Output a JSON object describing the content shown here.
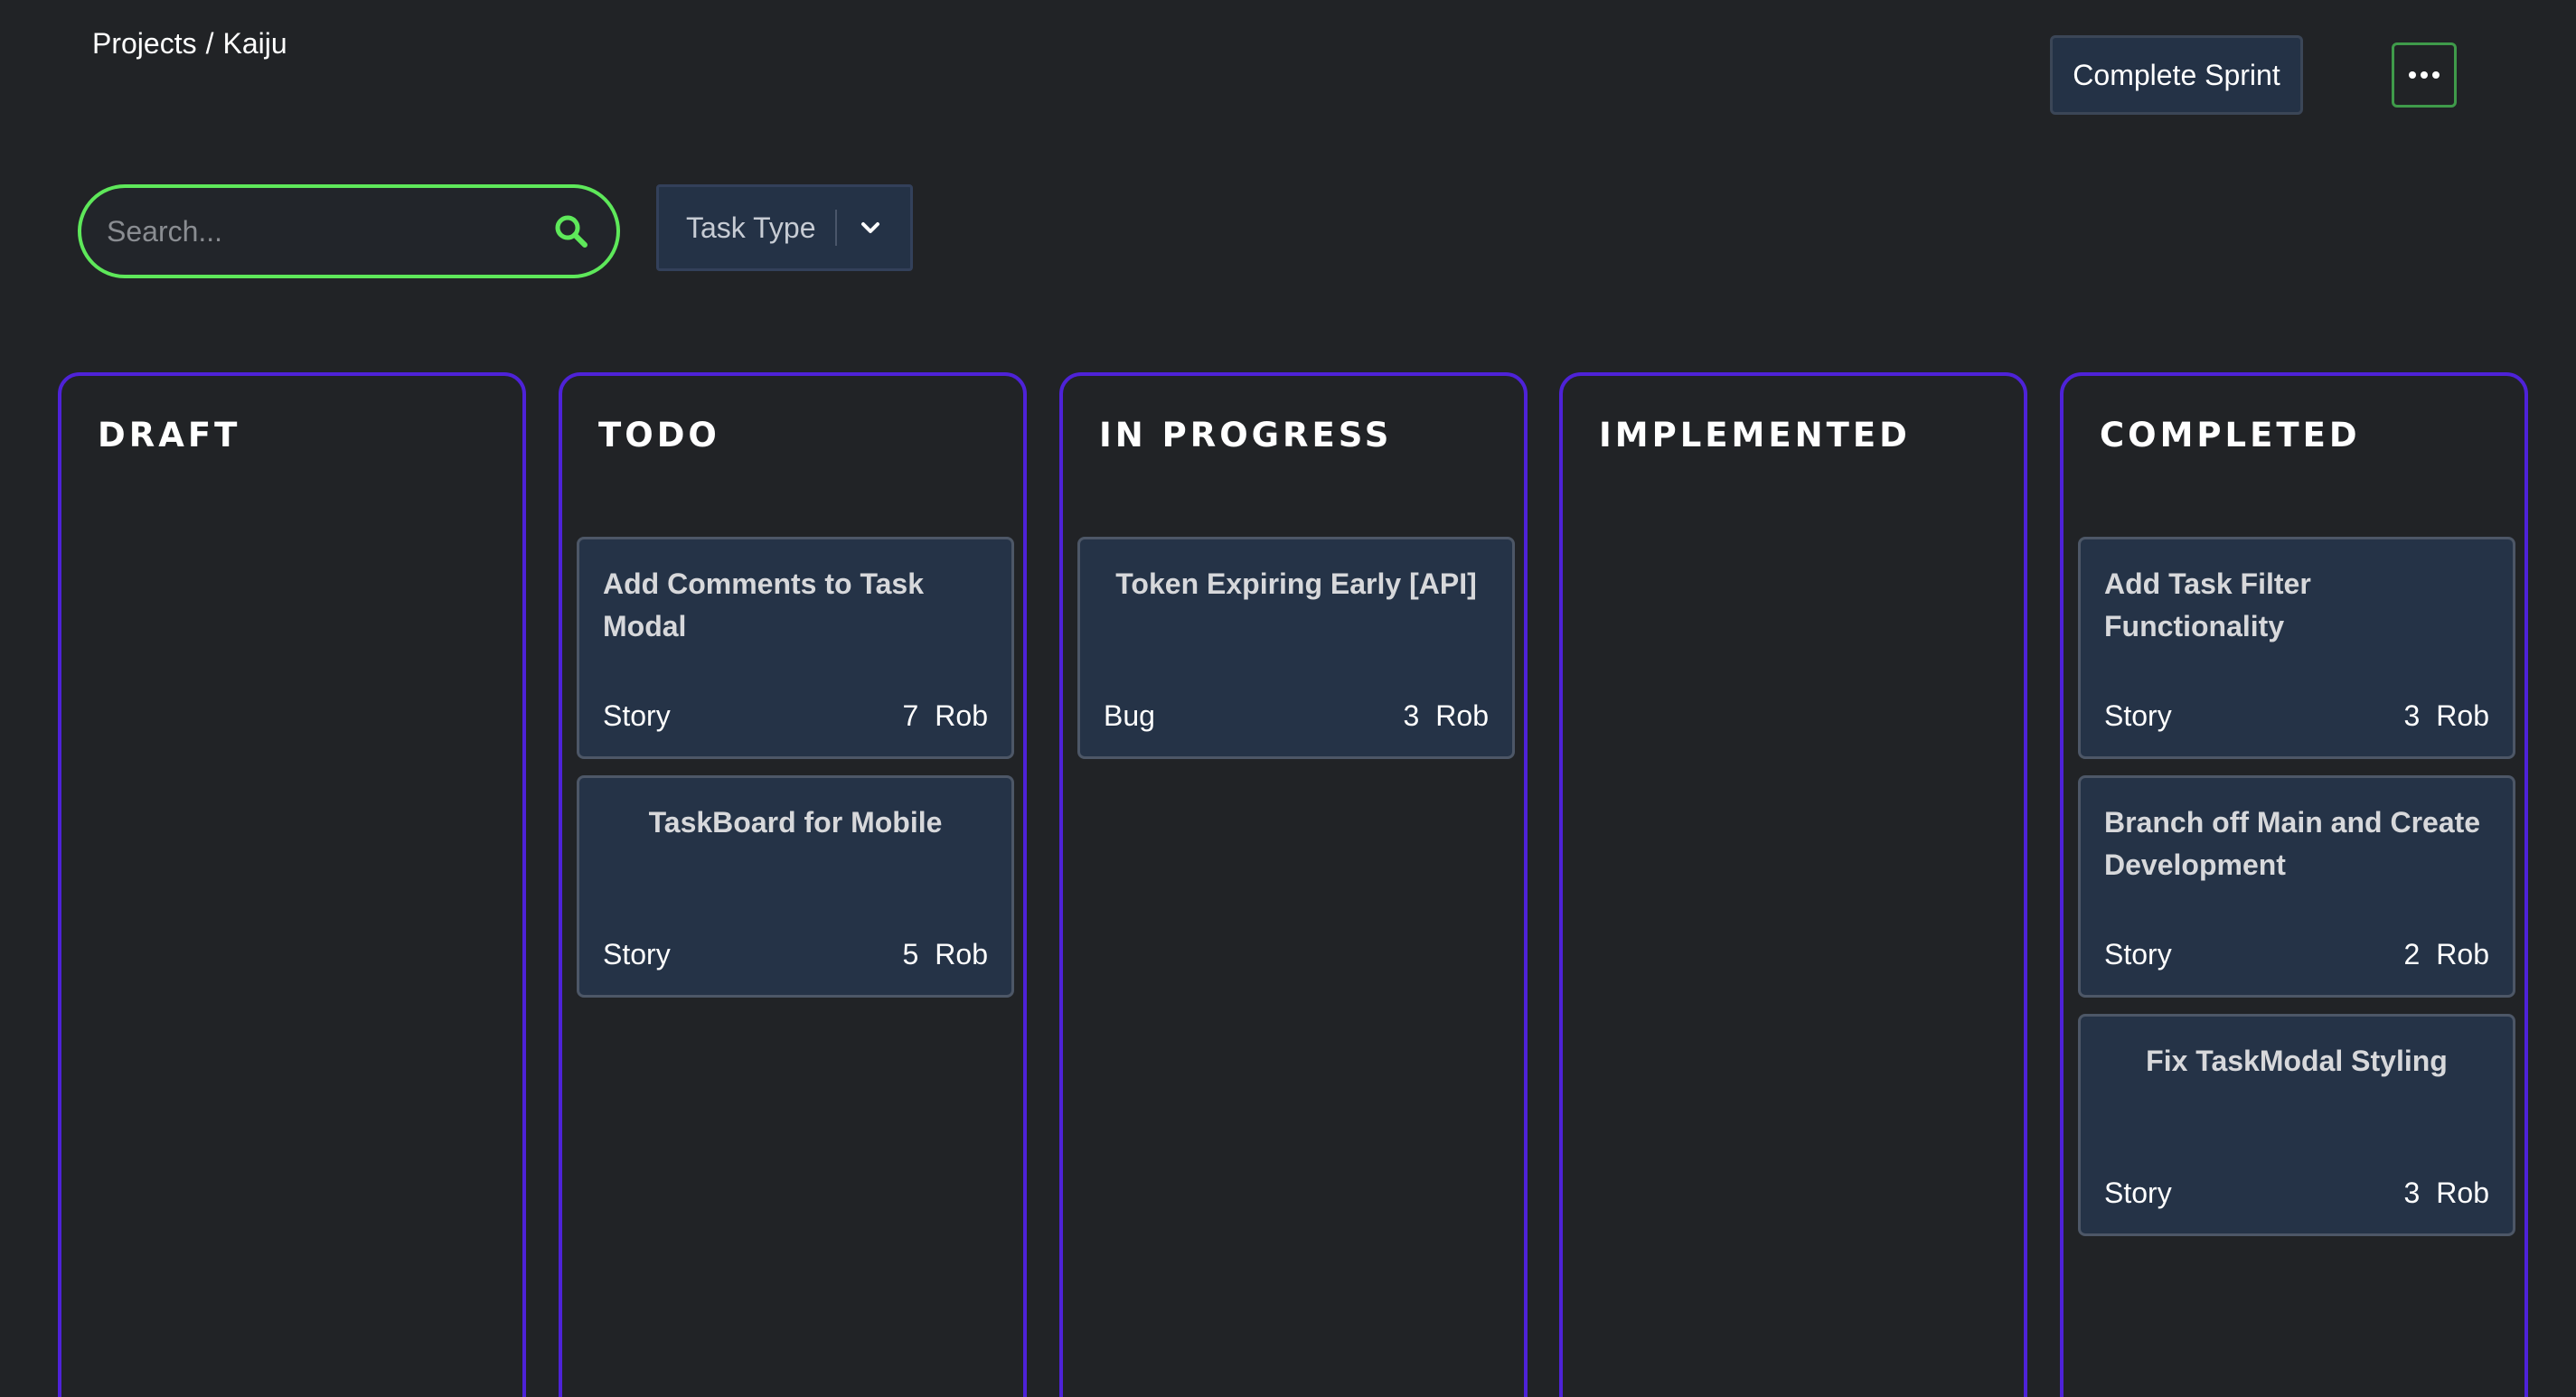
{
  "breadcrumb": {
    "root": "Projects",
    "separator": "/",
    "current": "Kaiju"
  },
  "header": {
    "complete_sprint_label": "Complete Sprint",
    "more_icon": "ellipsis-icon"
  },
  "search": {
    "placeholder": "Search...",
    "value": "",
    "icon": "search-icon"
  },
  "filter": {
    "task_type_label": "Task Type",
    "icon": "chevron-down-icon"
  },
  "colors": {
    "background": "#212326",
    "column_border": "#4e22d8",
    "card_background": "#253347",
    "search_border": "#5ee85a",
    "more_button_border": "#3f9b4a"
  },
  "columns": [
    {
      "title": "DRAFT",
      "cards": []
    },
    {
      "title": "TODO",
      "cards": [
        {
          "title": "Add Comments to Task Modal",
          "type": "Story",
          "points": "7",
          "assignee": "Rob"
        },
        {
          "title": "TaskBoard for Mobile",
          "type": "Story",
          "points": "5",
          "assignee": "Rob"
        }
      ]
    },
    {
      "title": "IN PROGRESS",
      "cards": [
        {
          "title": "Token Expiring Early [API]",
          "type": "Bug",
          "points": "3",
          "assignee": "Rob"
        }
      ]
    },
    {
      "title": "IMPLEMENTED",
      "cards": []
    },
    {
      "title": "COMPLETED",
      "cards": [
        {
          "title": "Add Task Filter Functionality",
          "type": "Story",
          "points": "3",
          "assignee": "Rob"
        },
        {
          "title": "Branch off Main and Create Development",
          "type": "Story",
          "points": "2",
          "assignee": "Rob"
        },
        {
          "title": "Fix TaskModal Styling",
          "type": "Story",
          "points": "3",
          "assignee": "Rob"
        }
      ]
    }
  ]
}
